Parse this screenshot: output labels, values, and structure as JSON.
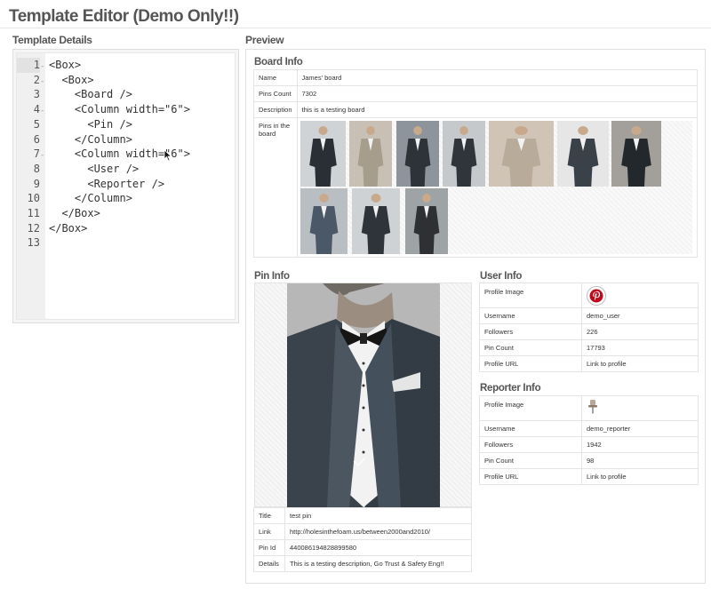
{
  "app": {
    "title": "Template Editor (Demo Only!!)"
  },
  "editor": {
    "heading": "Template Details",
    "lines": [
      {
        "n": "1",
        "fold": "-",
        "code": "<Box>"
      },
      {
        "n": "2",
        "fold": "-",
        "code": "  <Box>"
      },
      {
        "n": "3",
        "fold": "",
        "code": "    <Board />"
      },
      {
        "n": "4",
        "fold": "-",
        "code": "    <Column width=\"6\">"
      },
      {
        "n": "5",
        "fold": "",
        "code": "      <Pin />"
      },
      {
        "n": "6",
        "fold": "",
        "code": "    </Column>"
      },
      {
        "n": "7",
        "fold": "-",
        "code": "    <Column width=\"6\">"
      },
      {
        "n": "8",
        "fold": "",
        "code": "      <User />"
      },
      {
        "n": "9",
        "fold": "",
        "code": "      <Reporter />"
      },
      {
        "n": "10",
        "fold": "",
        "code": "    </Column>"
      },
      {
        "n": "11",
        "fold": "",
        "code": "  </Box>"
      },
      {
        "n": "12",
        "fold": "",
        "code": "</Box>"
      },
      {
        "n": "13",
        "fold": "",
        "code": ""
      }
    ]
  },
  "preview": {
    "heading": "Preview",
    "board": {
      "heading": "Board Info",
      "name_label": "Name",
      "name": "James' board",
      "pins_count_label": "Pins Count",
      "pins_count": "7302",
      "description_label": "Description",
      "description": "this is a testing board",
      "pins_label": "Pins in the board"
    },
    "pin": {
      "heading": "Pin Info",
      "title_label": "Title",
      "title": "test pin",
      "link_label": "Link",
      "link": "http://holesinthefoam.us/between2000and2010/",
      "id_label": "Pin Id",
      "id": "440086194828899580",
      "details_label": "Details",
      "details": "This is a testing description, Go Trust & Safety Eng!!"
    },
    "user": {
      "heading": "User Info",
      "profile_image_label": "Profile Image",
      "username_label": "Username",
      "username": "demo_user",
      "followers_label": "Followers",
      "followers": "226",
      "pin_count_label": "Pin Count",
      "pin_count": "17793",
      "profile_url_label": "Profile URL",
      "profile_url": "Link to profile"
    },
    "reporter": {
      "heading": "Reporter Info",
      "profile_image_label": "Profile Image",
      "username_label": "Username",
      "username": "demo_reporter",
      "followers_label": "Followers",
      "followers": "1942",
      "pin_count_label": "Pin Count",
      "pin_count": "98",
      "profile_url_label": "Profile URL",
      "profile_url": "Link to profile"
    }
  },
  "icons": {
    "cursor": "mouse-pointer-icon",
    "user_avatar": "pinterest-logo-icon",
    "reporter_avatar": "pushpin-icon",
    "fold": "fold-arrow-icon"
  },
  "colors": {
    "heading": "#555555",
    "border": "#e4e4e4",
    "pinterest_red": "#bd081c"
  }
}
